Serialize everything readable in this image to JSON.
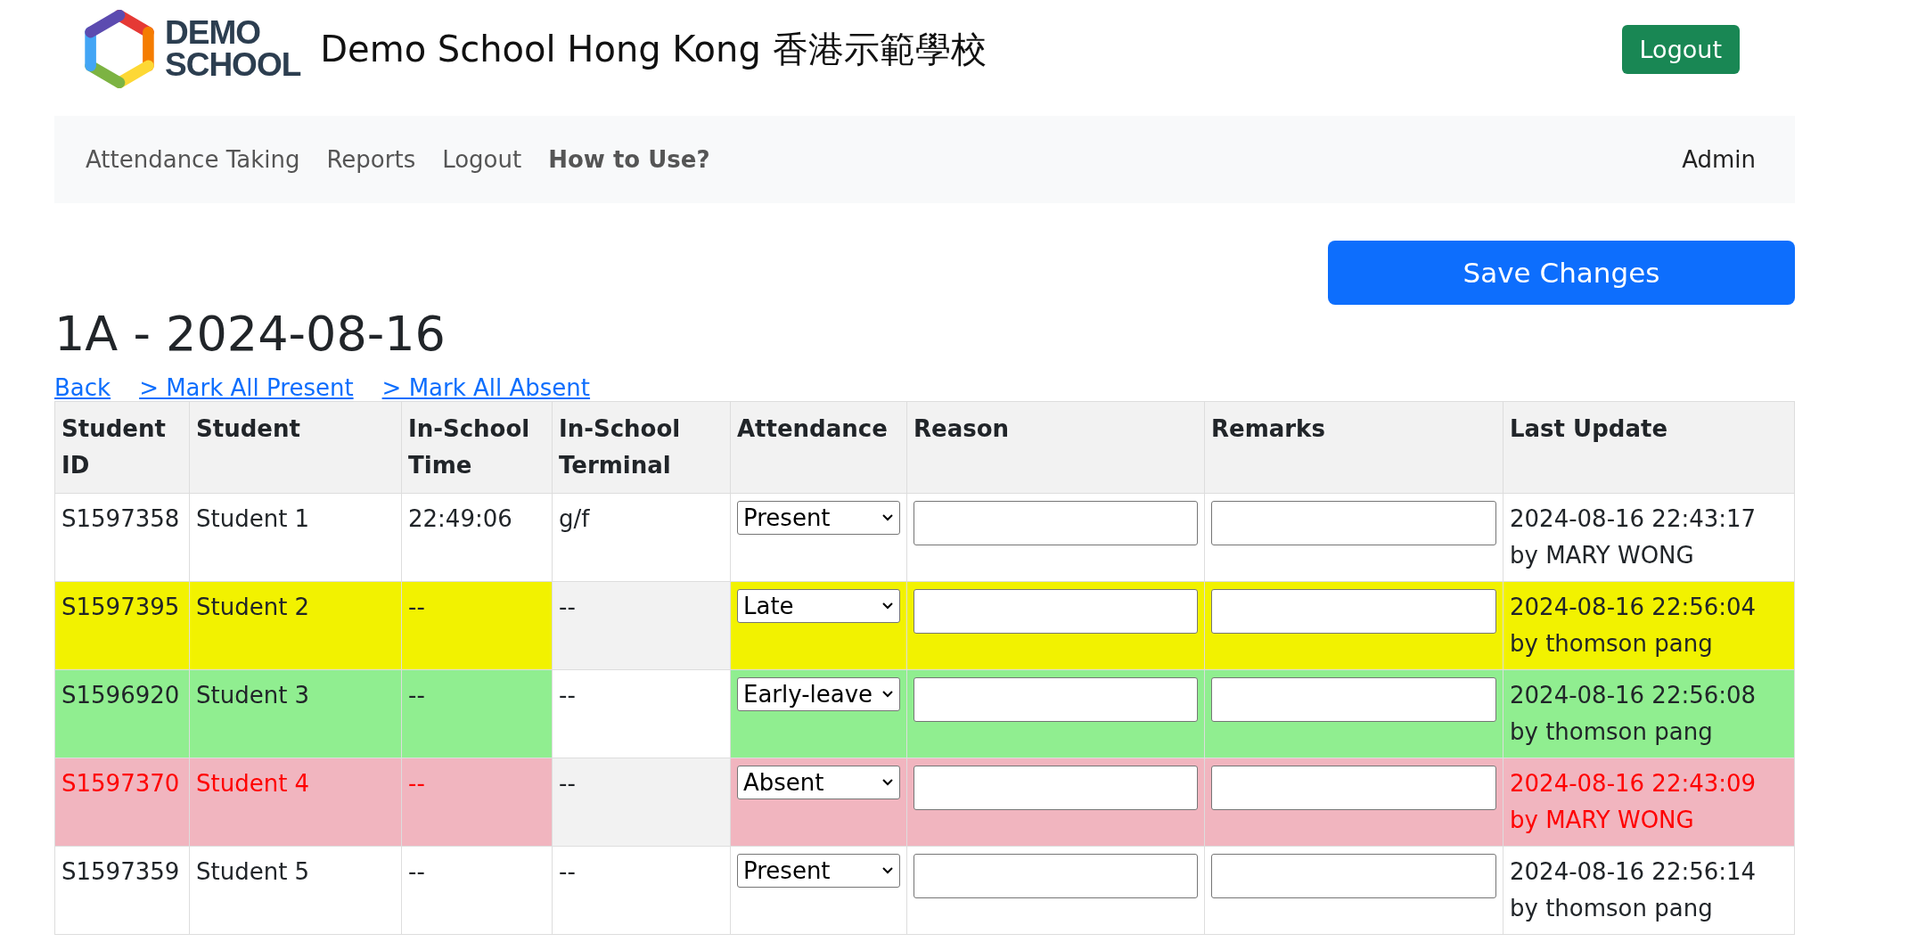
{
  "header": {
    "logo_text": [
      "DEMO",
      "SCHOOL"
    ],
    "title": "Demo School Hong Kong 香港示範學校",
    "logout_button": "Logout"
  },
  "navbar": {
    "items": [
      {
        "label": "Attendance Taking",
        "bold": false
      },
      {
        "label": "Reports",
        "bold": false
      },
      {
        "label": "Logout",
        "bold": false
      },
      {
        "label": "How to Use?",
        "bold": true
      }
    ],
    "user": "Admin"
  },
  "save_button": "Save Changes",
  "heading": "1A - 2024-08-16",
  "links": [
    "Back",
    "> Mark All Present",
    "> Mark All Absent"
  ],
  "table": {
    "columns": [
      "Student ID",
      "Student",
      "In-School Time",
      "In-School Terminal",
      "Attendance",
      "Reason",
      "Remarks",
      "Last Update"
    ],
    "rows": [
      {
        "kind": "present",
        "student_id": "S1597358",
        "student": "Student 1",
        "time": "22:49:06",
        "terminal": "g/f",
        "attendance": "Present",
        "last_update": "2024-08-16 22:43:17 by MARY WONG"
      },
      {
        "kind": "late",
        "student_id": "S1597395",
        "student": "Student 2",
        "time": "--",
        "terminal": "--",
        "attendance": "Late",
        "last_update": "2024-08-16 22:56:04 by thomson pang"
      },
      {
        "kind": "early-leave",
        "student_id": "S1596920",
        "student": "Student 3",
        "time": "--",
        "terminal": "--",
        "attendance": "Early-leave",
        "last_update": "2024-08-16 22:56:08 by thomson pang"
      },
      {
        "kind": "absent",
        "student_id": "S1597370",
        "student": "Student 4",
        "time": "--",
        "terminal": "--",
        "attendance": "Absent",
        "last_update": "2024-08-16 22:43:09 by MARY WONG"
      },
      {
        "kind": "present",
        "student_id": "S1597359",
        "student": "Student 5",
        "time": "--",
        "terminal": "--",
        "attendance": "Present",
        "last_update": "2024-08-16 22:56:14 by thomson pang"
      }
    ]
  }
}
